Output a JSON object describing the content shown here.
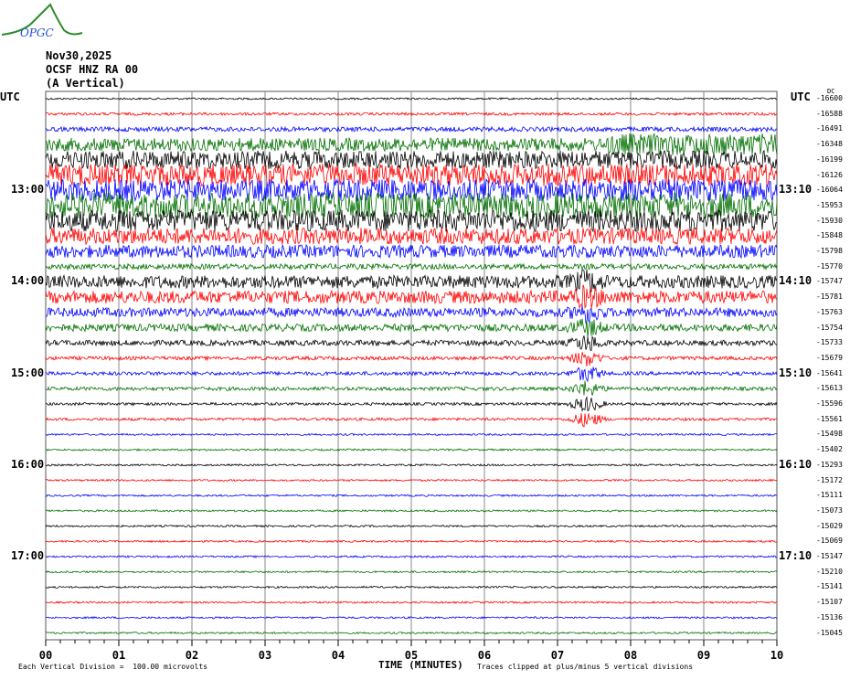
{
  "header": {
    "date": "Nov30,2025",
    "station": "OCSF HNZ RA 00",
    "component": "(A Vertical)",
    "logo": "OPGC"
  },
  "chart_data": {
    "type": "line",
    "title": "Nov30,2025 OCSF HNZ RA 00 (A Vertical)",
    "xlabel": "TIME (MINUTES)",
    "x_ticks": [
      "00",
      "01",
      "02",
      "03",
      "04",
      "05",
      "06",
      "07",
      "08",
      "09",
      "10"
    ],
    "xlim": [
      0,
      10
    ],
    "utc_label_left": "UTC",
    "utc_label_right": "UTC",
    "dc_label": "DC",
    "left_hour_labels": [
      {
        "trace": 6,
        "label": "13:00"
      },
      {
        "trace": 12,
        "label": "14:00"
      },
      {
        "trace": 18,
        "label": "15:00"
      },
      {
        "trace": 24,
        "label": "16:00"
      },
      {
        "trace": 30,
        "label": "17:00"
      }
    ],
    "right_hour_labels": [
      {
        "trace": 6,
        "label": "13:10"
      },
      {
        "trace": 12,
        "label": "14:10"
      },
      {
        "trace": 18,
        "label": "15:10"
      },
      {
        "trace": 24,
        "label": "16:10"
      },
      {
        "trace": 30,
        "label": "17:10"
      }
    ],
    "dc_offsets": [
      "-16600",
      "-16588",
      "-16491",
      "-16348",
      "-16199",
      "-16126",
      "-16064",
      "-15953",
      "-15930",
      "-15848",
      "-15798",
      "-15770",
      "-15747",
      "-15781",
      "-15763",
      "-15754",
      "-15733",
      "-15679",
      "-15641",
      "-15613",
      "-15596",
      "-15561",
      "-15498",
      "-15402",
      "-15293",
      "-15172",
      "-15111",
      "-15073",
      "-15029",
      "-15069",
      "-15147",
      "-15210",
      "-15141",
      "-15107",
      "-15136",
      "-15045"
    ],
    "trace_colors": [
      "#000000",
      "#ff0000",
      "#0000ff",
      "#007000"
    ],
    "trace_amplitude_divisions": [
      0.1,
      0.15,
      0.25,
      1.2,
      1.0,
      1.2,
      1.2,
      1.4,
      1.2,
      0.9,
      0.7,
      0.3,
      0.7,
      0.7,
      0.5,
      0.4,
      0.3,
      0.2,
      0.2,
      0.2,
      0.15,
      0.15,
      0.1,
      0.1,
      0.1,
      0.1,
      0.1,
      0.1,
      0.1,
      0.1,
      0.1,
      0.1,
      0.1,
      0.1,
      0.1,
      0.1
    ],
    "event_minute": 7.4,
    "footer_left": "Each Vertical Division =  100.00 microvolts",
    "footer_right": "Traces clipped at plus/minus 5 vertical divisions"
  }
}
